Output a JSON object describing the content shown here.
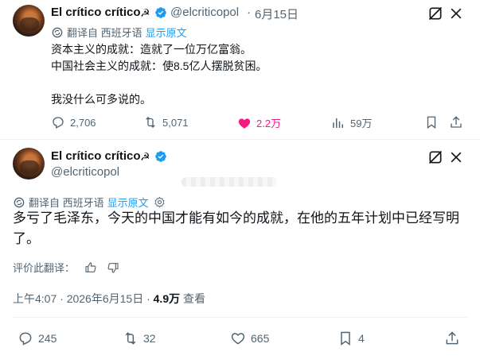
{
  "tweet1": {
    "author_name": "El crítico crítico",
    "sickle": "☭",
    "handle": "@elcriticopol",
    "dot": "·",
    "date": "6月15日",
    "translated_from": "翻译自 西班牙语",
    "show_original": "显示原文",
    "lines": [
      "资本主义的成就：造就了一位万亿富翁。",
      "中国社会主义的成就：使8.5亿人摆脱贫困。",
      "",
      "我没什么可多说的。"
    ],
    "actions": {
      "replies": "2,706",
      "retweets": "5,071",
      "likes": "2.2万",
      "views": "59万"
    }
  },
  "tweet2": {
    "author_name": "El crítico crítico",
    "sickle": "☭",
    "handle": "@elcriticopol",
    "translated_from": "翻译自 西班牙语",
    "show_original": "显示原文",
    "text": "多亏了毛泽东，今天的中国才能有如今的成就，在他的五年计划中已经写明了。",
    "rate_label": "评价此翻译：",
    "time": "上午4:07 · 2026年6月15日 · ",
    "views_count": "4.9万",
    "views_label": " 查看",
    "actions": {
      "replies": "245",
      "retweets": "32",
      "likes": "665",
      "bookmarks": "4"
    }
  },
  "colors": {
    "accent": "#1d9bf0",
    "like": "#f91880",
    "muted": "#536471",
    "text": "#0f1419"
  },
  "icons": [
    "grok-icon",
    "more-icon",
    "translate-icon",
    "settings-icon",
    "reply-icon",
    "retweet-icon",
    "like-icon",
    "views-icon",
    "bookmark-icon",
    "share-icon",
    "thumbs-up-icon",
    "thumbs-down-icon",
    "verified-badge-icon"
  ]
}
